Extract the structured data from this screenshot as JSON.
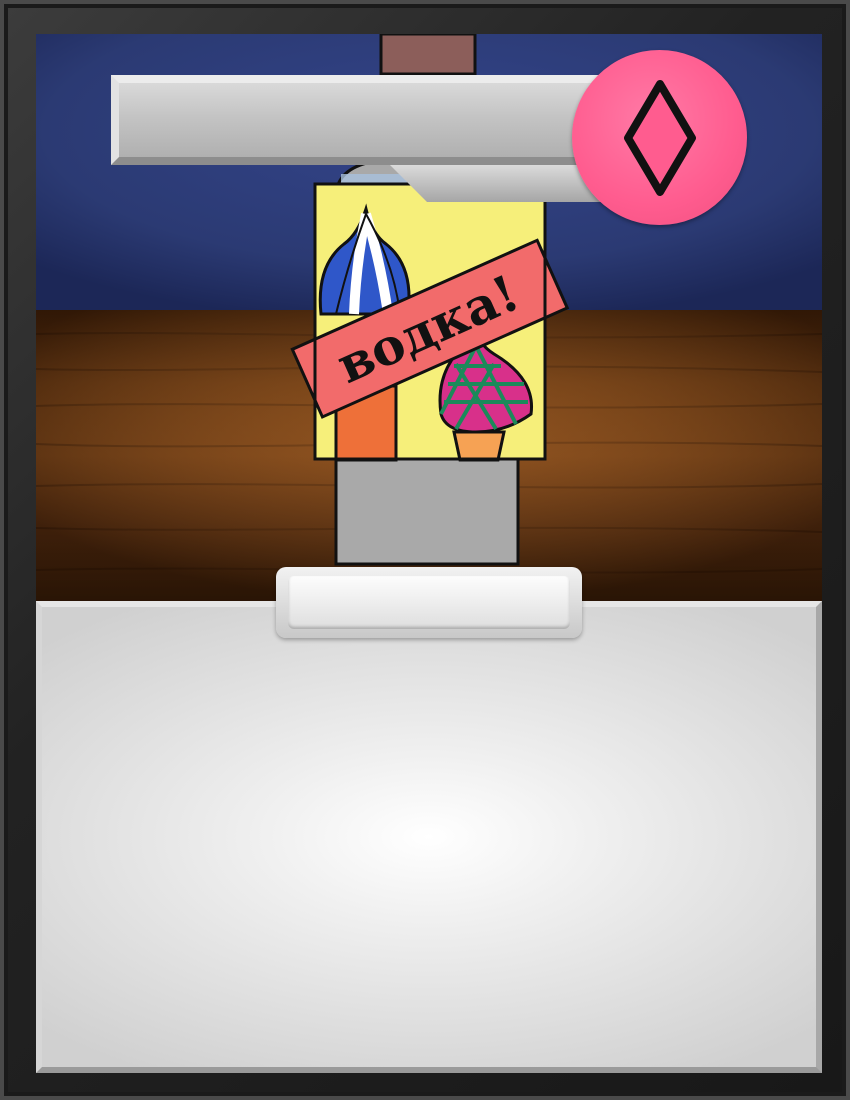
{
  "card": {
    "name": "",
    "type_line": "",
    "cost": "",
    "rules_text": "",
    "suit_icon": "diamond-icon",
    "bottle_label": "водка!"
  },
  "colors": {
    "sky": "#2b3a73",
    "table_wood": "#6a3a12",
    "label_yellow": "#f6ef7a",
    "ribbon_red": "#f26b6b",
    "suit_badge": "#ff5c8f",
    "cap": "#8c5e5a",
    "glass_grey": "#a8a8a8"
  }
}
